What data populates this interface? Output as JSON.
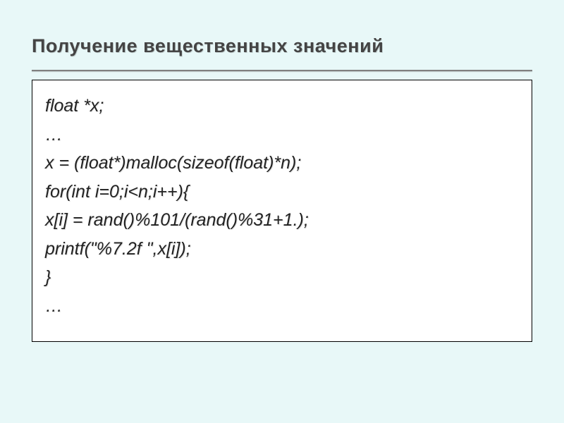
{
  "title": "Получение вещественных значений",
  "code": {
    "lines": [
      "float *x;",
      "…",
      "x = (float*)malloc(sizeof(float)*n);",
      "for(int i=0;i<n;i++){",
      "x[i] = rand()%101/(rand()%31+1.);",
      "printf(\"%7.2f \",x[i]);",
      "}",
      "…"
    ]
  }
}
